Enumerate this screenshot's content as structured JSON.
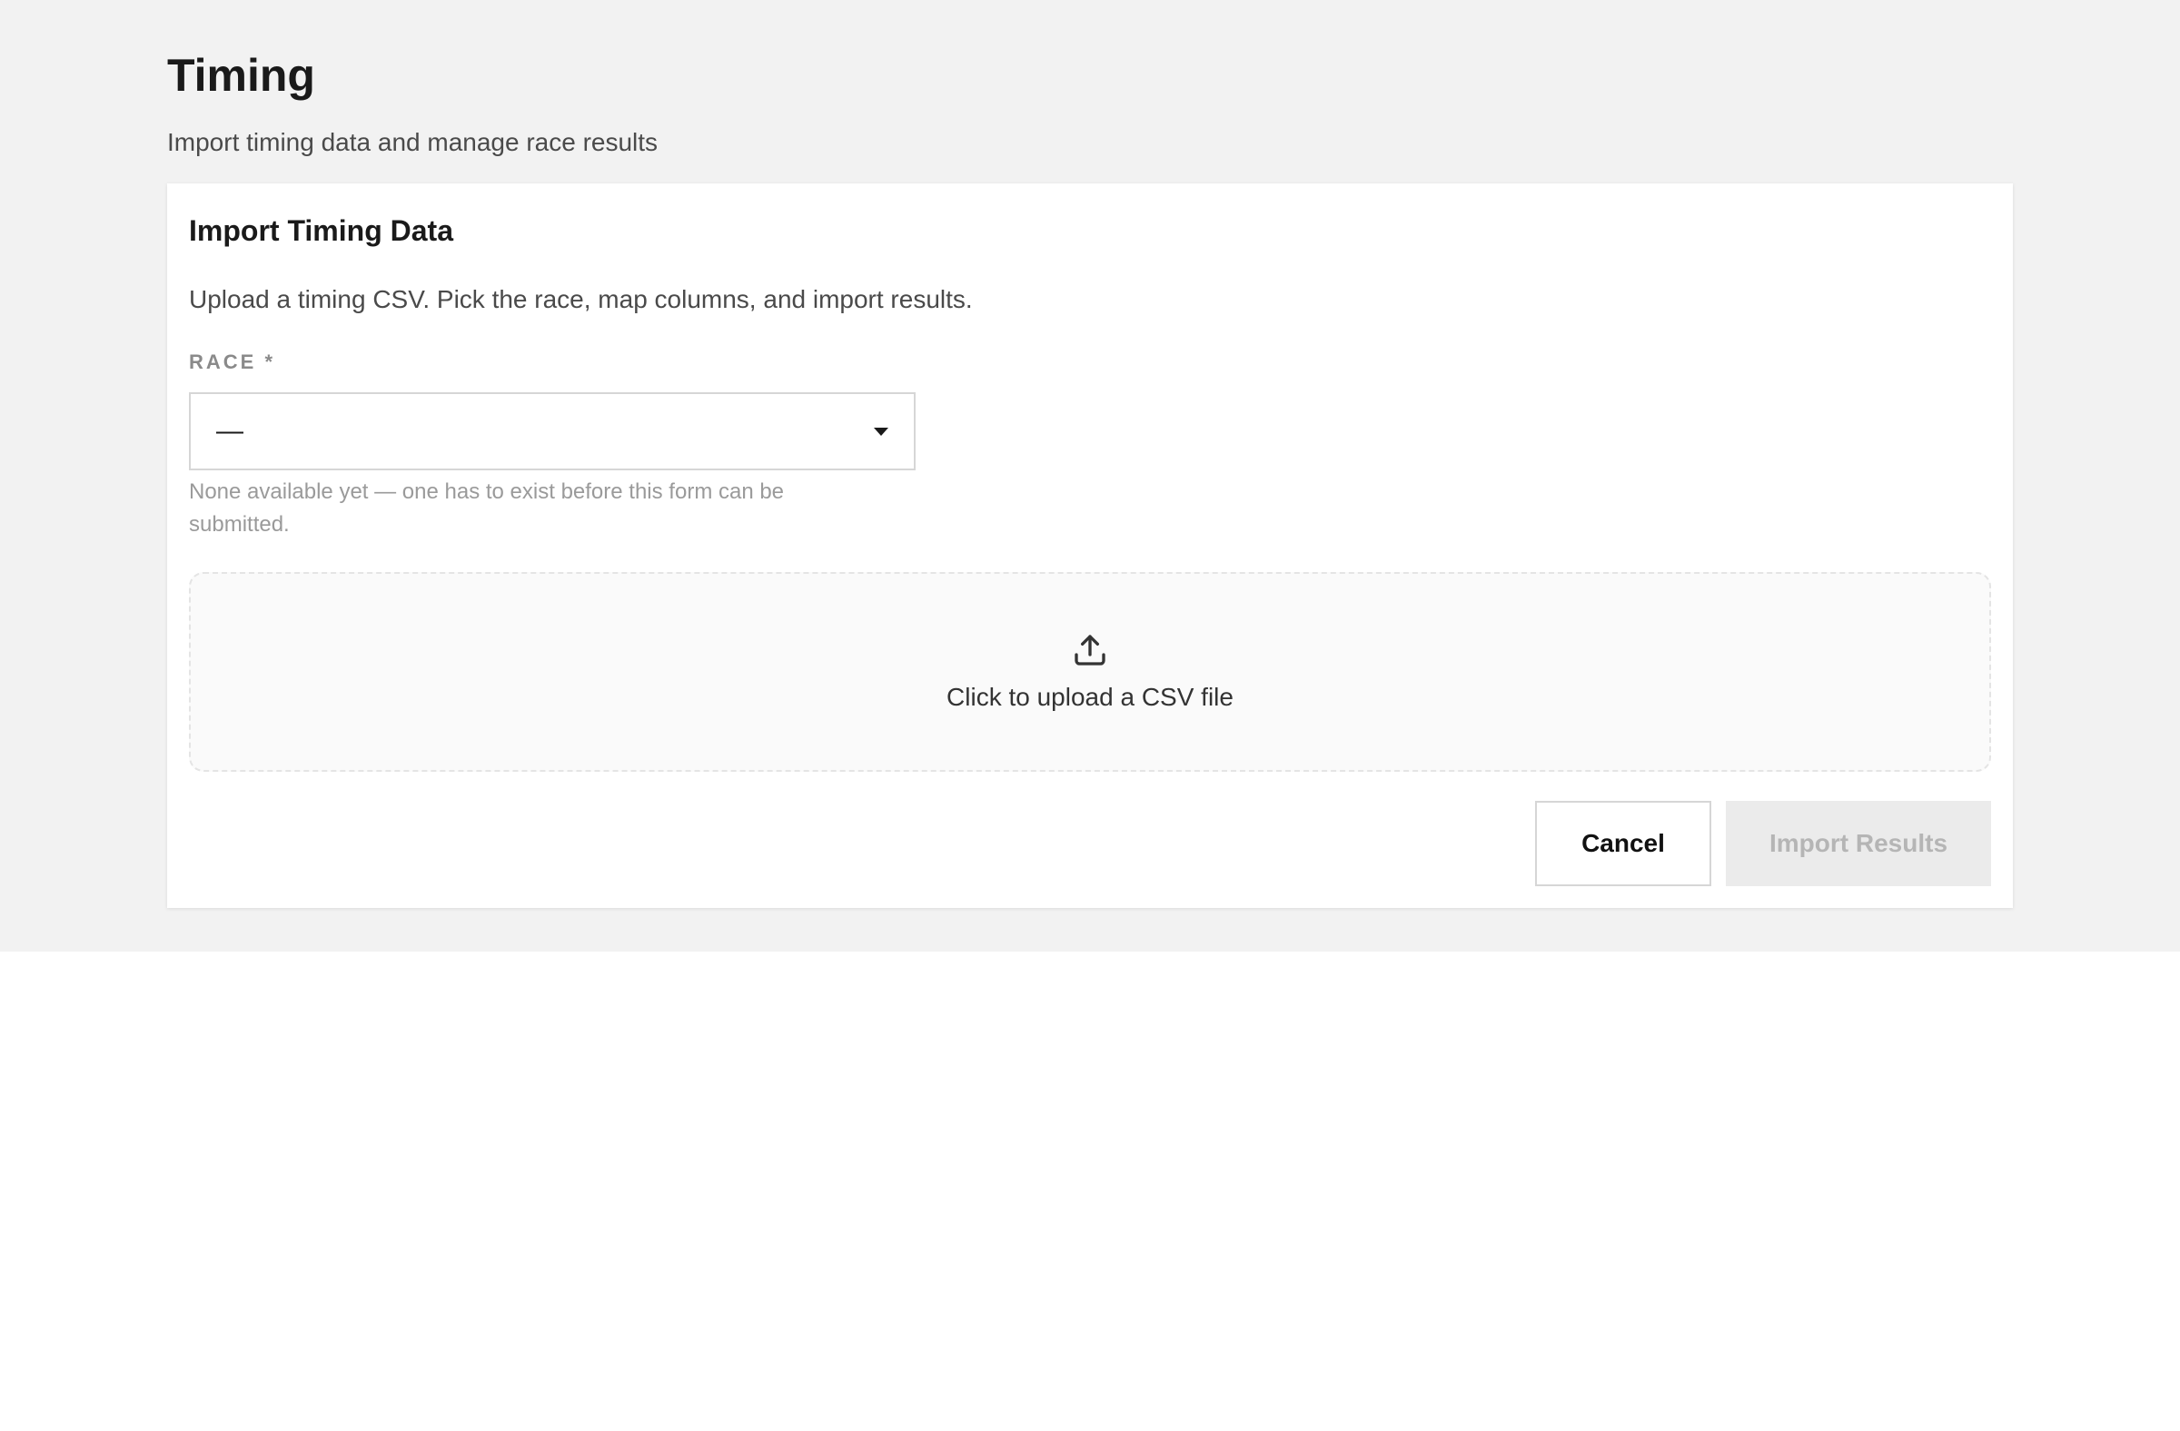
{
  "page": {
    "title": "Timing",
    "subtitle": "Import timing data and manage race results"
  },
  "card": {
    "title": "Import Timing Data",
    "description": "Upload a timing CSV. Pick the race, map columns, and import results."
  },
  "race_field": {
    "label": "RACE *",
    "selected_value": "—",
    "help_text": "None available yet — one has to exist before this form can be submitted."
  },
  "upload": {
    "icon": "upload-icon",
    "label": "Click to upload a CSV file"
  },
  "actions": {
    "cancel_label": "Cancel",
    "import_label": "Import Results"
  },
  "colors": {
    "page_background": "#f2f2f2",
    "card_background": "#ffffff",
    "disabled_button_bg": "#ebebeb",
    "disabled_button_text": "#b5b5b5"
  }
}
